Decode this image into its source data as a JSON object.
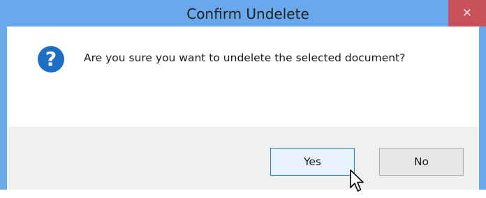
{
  "window": {
    "title": "Confirm Undelete",
    "close_glyph": "✕"
  },
  "dialog": {
    "icon": "question-icon",
    "icon_glyph": "?",
    "message": "Are you sure you want to undelete the selected document?"
  },
  "buttons": {
    "yes_label": "Yes",
    "no_label": "No"
  },
  "colors": {
    "titlebar": "#69a8ea",
    "close_button": "#c7505a",
    "icon": "#1d6fc6",
    "footer": "#f0f0f0"
  }
}
